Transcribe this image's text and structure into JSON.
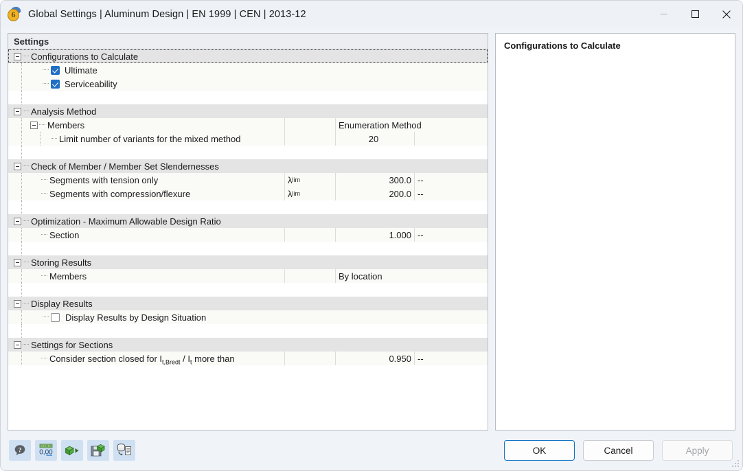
{
  "window": {
    "title": "Global Settings | Aluminum Design | EN 1999 | CEN | 2013-12",
    "app_icon": "rfem6-icon",
    "minimize_label": "Minimize",
    "maximize_label": "Maximize",
    "close_label": "Close"
  },
  "left_pane": {
    "header": "Settings"
  },
  "right_pane": {
    "title": "Configurations to Calculate"
  },
  "tree": {
    "groups": [
      {
        "title": "Configurations to Calculate",
        "rows": [
          {
            "kind": "checkbox",
            "label": "Ultimate",
            "checked": true
          },
          {
            "kind": "checkbox",
            "label": "Serviceability",
            "checked": true
          }
        ]
      },
      {
        "title": "Analysis Method",
        "rows": [
          {
            "kind": "node",
            "label": "Members",
            "value": "Enumeration Method"
          },
          {
            "kind": "leaf",
            "label": "Limit number of variants for the mixed method",
            "value": "20"
          }
        ]
      },
      {
        "title": "Check of Member / Member Set Slendernesses",
        "rows": [
          {
            "kind": "leaf",
            "label": "Segments with tension only",
            "symbol": "λlim",
            "value": "300.0",
            "unit": "--"
          },
          {
            "kind": "leaf",
            "label": "Segments with compression/flexure",
            "symbol": "λlim",
            "value": "200.0",
            "unit": "--"
          }
        ]
      },
      {
        "title": "Optimization - Maximum Allowable Design Ratio",
        "rows": [
          {
            "kind": "leaf",
            "label": "Section",
            "value": "1.000",
            "unit": "--"
          }
        ]
      },
      {
        "title": "Storing Results",
        "rows": [
          {
            "kind": "leaf",
            "label": "Members",
            "value": "By location"
          }
        ]
      },
      {
        "title": "Display Results",
        "rows": [
          {
            "kind": "checkbox",
            "label": "Display Results by Design Situation",
            "checked": false
          }
        ]
      },
      {
        "title": "Settings for Sections",
        "rows": [
          {
            "kind": "leaf",
            "label": "Consider section closed for It,Bredt / It more than",
            "value": "0.950",
            "unit": "--"
          }
        ]
      }
    ]
  },
  "labels": {
    "ultimate": "Ultimate",
    "serviceability": "Serviceability",
    "members": "Members",
    "limit_variants": "Limit number of variants for the mixed method",
    "enumeration_method": "Enumeration Method",
    "limit_variants_value": "20",
    "tension_only": "Segments with tension only",
    "compression_flexure": "Segments with compression/flexure",
    "lambda_sym": "λ",
    "lambda_sub": "lim",
    "tension_value": "300.0",
    "compression_value": "200.0",
    "dash": "--",
    "section": "Section",
    "section_value": "1.000",
    "storing_members": "Members",
    "storing_value": "By location",
    "display_by_situation": "Display Results by Design Situation",
    "closed_prefix": "Consider section closed for I",
    "closed_sub1": "t,Bredt",
    "closed_mid": " / I",
    "closed_sub2": "t",
    "closed_suffix": " more than",
    "closed_value": "0.950"
  },
  "groups_titles": {
    "g0": "Configurations to Calculate",
    "g1": "Analysis Method",
    "g2": "Check of Member / Member Set Slendernesses",
    "g3": "Optimization - Maximum Allowable Design Ratio",
    "g4": "Storing Results",
    "g5": "Display Results",
    "g6": "Settings for Sections"
  },
  "toolbar": [
    {
      "name": "help-icon",
      "tip": "Help"
    },
    {
      "name": "number-format-icon",
      "tip": "Units and Decimal Places",
      "text": "0,00"
    },
    {
      "name": "import-icon",
      "tip": "Import"
    },
    {
      "name": "save-icon",
      "tip": "Save"
    },
    {
      "name": "database-export-icon",
      "tip": "Export to Library"
    }
  ],
  "buttons": {
    "ok": "OK",
    "cancel": "Cancel",
    "apply": "Apply",
    "apply_disabled": true
  },
  "colors": {
    "accent": "#1f6fc4",
    "default_button_border": "#1173c4",
    "group_header_bg": "#e4e4e4",
    "row_bg": "#fafaf7",
    "toolbar_button_bg": "#cfe0f2",
    "titlebar_bg": "#eef2f6"
  }
}
